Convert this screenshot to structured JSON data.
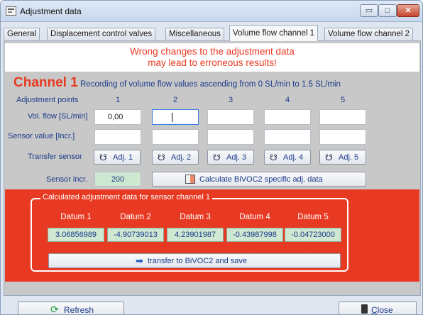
{
  "window": {
    "title": "Adjustment data"
  },
  "title_buttons": {
    "minimize": "▭",
    "maximize": "□",
    "close": "✕"
  },
  "tabs": [
    {
      "label": "General"
    },
    {
      "label": "Displacement control valves"
    },
    {
      "label": "Miscellaneous"
    },
    {
      "label": "Volume flow channel 1"
    },
    {
      "label": "Volume flow channel 2"
    }
  ],
  "active_tab": "Volume flow channel 1",
  "warning": {
    "line1": "Wrong changes to the adjustment data",
    "line2": "may lead to erroneous results!"
  },
  "channel": {
    "title": "Channel 1",
    "subtitle": "Recording of volume flow values ascending from 0 SL/min to 1.5 SL/min"
  },
  "grid": {
    "adjustment_points_label": "Adjustment points",
    "columns": [
      "1",
      "2",
      "3",
      "4",
      "5"
    ],
    "vol_flow_label": "Vol. flow [SL/min]",
    "vol_flow_values": [
      "0,00",
      "",
      "",
      "",
      ""
    ],
    "sensor_value_label": "Sensor value [Incr.]",
    "sensor_values": [
      "",
      "",
      "",
      "",
      ""
    ],
    "transfer_sensor_label": "Transfer sensor",
    "adj_buttons": [
      "Adj. 1",
      "Adj. 2",
      "Adj. 3",
      "Adj. 4",
      "Adj. 5"
    ],
    "sensor_incr_label": "Sensor incr.",
    "sensor_incr_value": "200",
    "calc_button": "Calculate BiVOC2 specific adj. data"
  },
  "calculated": {
    "group_title": "Calculated adjustment data for sensor channel 1",
    "datum_labels": [
      "Datum 1",
      "Datum 2",
      "Datum 3",
      "Datum 4",
      "Datum 5"
    ],
    "datum_values": [
      "3.06856989",
      "-4.90739013",
      "4.23901987",
      "-0.43987998",
      "-0.04723000"
    ],
    "transfer_button": "transfer to BiVOC2 and save"
  },
  "bottom": {
    "refresh_label": "Refresh",
    "close_label": "Close"
  },
  "colors": {
    "warning_red": "#e83a22",
    "label_blue": "#1c3a8a",
    "value_green": "#cfe8d2",
    "panel_gray": "#c8c8c8"
  }
}
